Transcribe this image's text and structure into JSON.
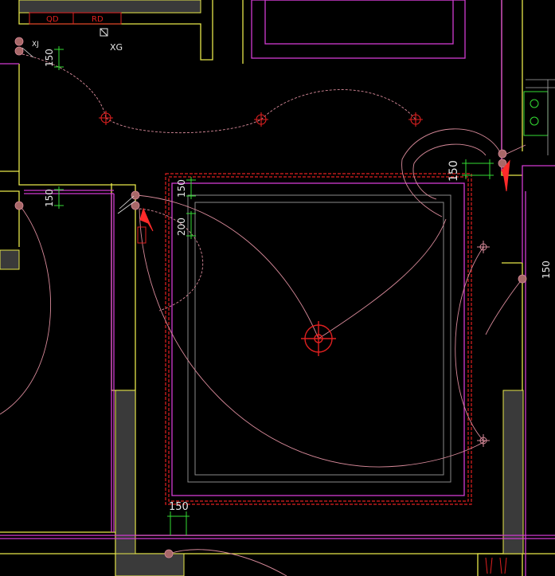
{
  "title": "",
  "colors": {
    "background": "#000000",
    "wall_yellow": "#e8e84a",
    "wall_magenta": "#d13bd1",
    "ceiling_red": "#e02020",
    "wire_pink": "#d88a9a",
    "dimension_green": "#33dd33",
    "fill_gray": "#3a3a3a",
    "white": "#e6e6e6",
    "switch_dot": "#a86868",
    "arrow_red": "#ff2a2a"
  },
  "labels": {
    "tag_qd": "QD",
    "tag_rd": "RD",
    "tag_xg": "XG",
    "tag_xj": "XJ"
  },
  "dimensions": {
    "d1": "150",
    "d2": "150",
    "d3": "150",
    "d4": "200",
    "d5": "150",
    "d6": "150",
    "d7": "150"
  },
  "icons": {
    "ceiling_light": "crosshair-circle-icon",
    "main_light": "double-circle-crosshair-icon",
    "switch": "filled-dot-icon",
    "socket_arrow": "red-arrow-icon"
  }
}
